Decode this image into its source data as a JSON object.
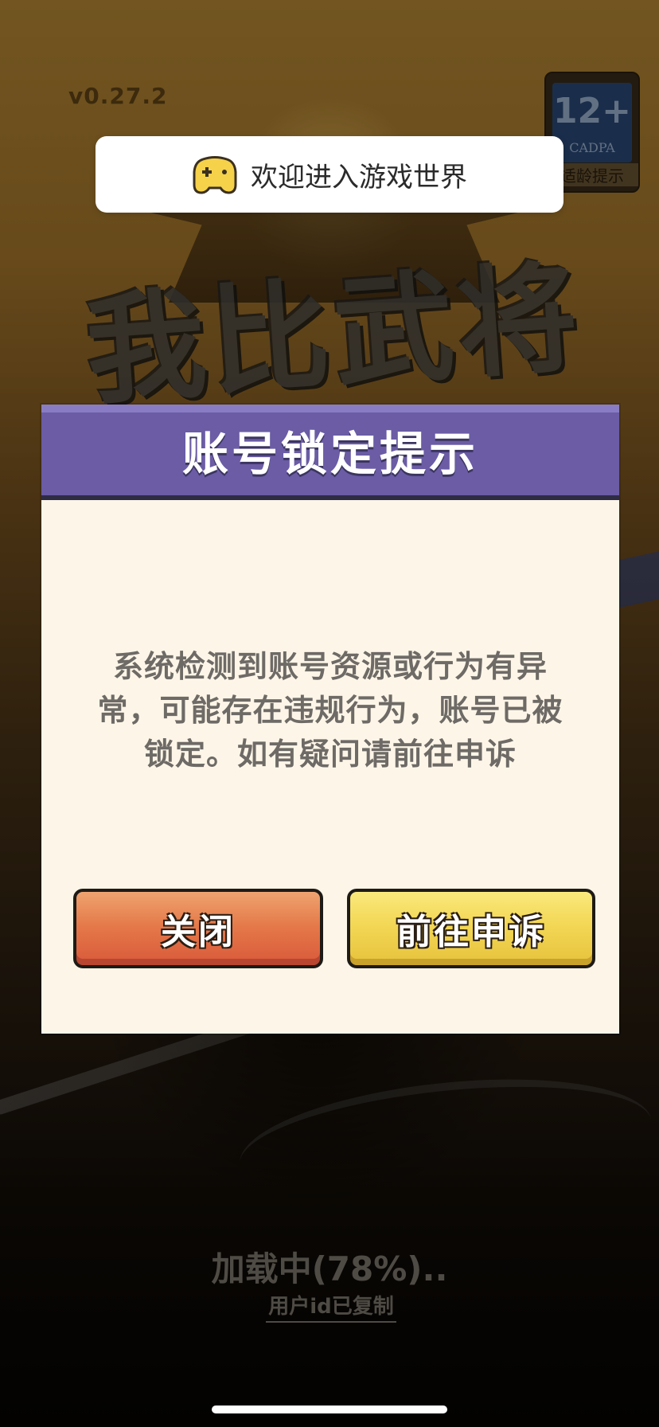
{
  "app": {
    "version": "v0.27.2",
    "title_art": "我比武将牛"
  },
  "age_rating": {
    "number": "12+",
    "org": "CADPA",
    "label": "适龄提示"
  },
  "toast": {
    "icon": "gamepad-icon",
    "text": "欢迎进入游戏世界"
  },
  "dialog": {
    "title": "账号锁定提示",
    "message": "系统检测到账号资源或行为有异常，可能存在违规行为，账号已被锁定。如有疑问请前往申诉",
    "buttons": {
      "close": "关闭",
      "appeal": "前往申诉"
    }
  },
  "loading": {
    "text": "加载中(78%)..",
    "copy_status": "用户id已复制"
  },
  "colors": {
    "dialog_header": "#6b5ca5",
    "dialog_body": "#fdf6e8",
    "close_button": "#e57a4a",
    "appeal_button": "#f3d755"
  }
}
